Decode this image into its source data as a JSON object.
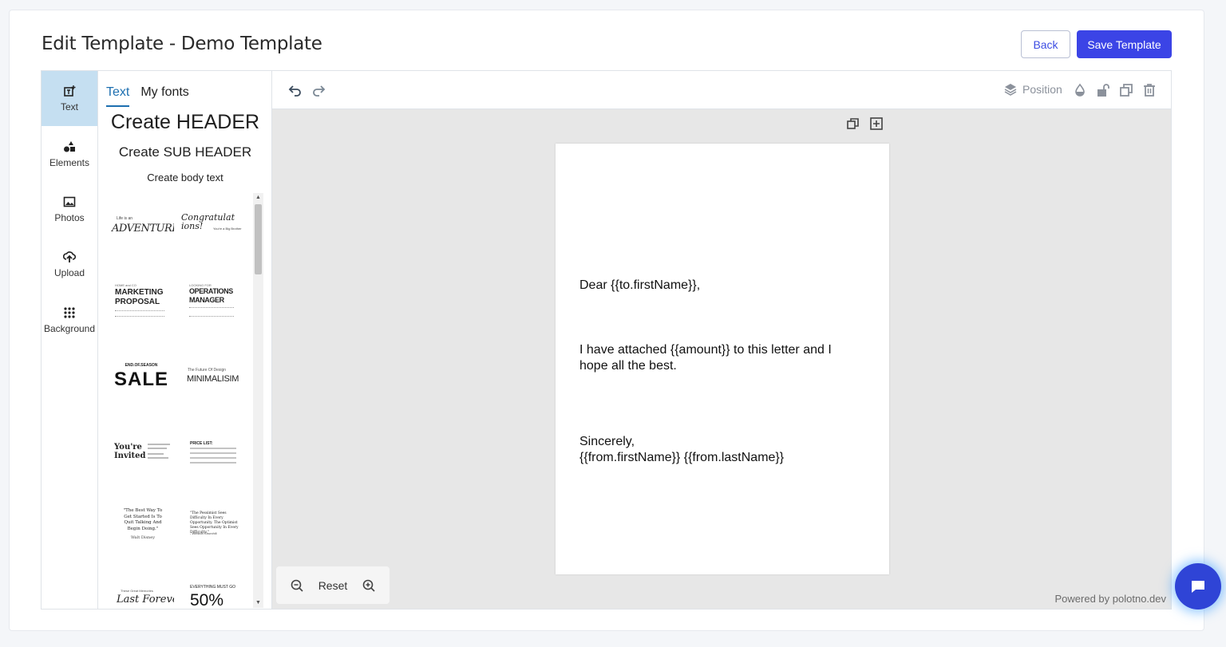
{
  "header": {
    "title": "Edit Template - Demo Template",
    "back_label": "Back",
    "save_label": "Save Template"
  },
  "side_tabs": [
    {
      "label": "Text",
      "icon": "text-add-icon",
      "active": true
    },
    {
      "label": "Elements",
      "icon": "shapes-icon"
    },
    {
      "label": "Photos",
      "icon": "image-icon"
    },
    {
      "label": "Upload",
      "icon": "upload-icon"
    },
    {
      "label": "Background",
      "icon": "dots-grid-icon"
    }
  ],
  "text_panel": {
    "tabs": [
      "Text",
      "My fonts"
    ],
    "active_tab": "Text",
    "create_header": "Create HEADER",
    "create_sub_header": "Create SUB HEADER",
    "create_body": "Create body text",
    "templates": [
      {
        "small": "Life is an",
        "main": "ADVENTURE"
      },
      {
        "main": "Congratulat ions!",
        "small": "You're a Big Brother"
      },
      {
        "small": "HOME and CO",
        "main": "MARKETING PROPOSAL"
      },
      {
        "small": "LOOKING FOR",
        "main": "OPERATIONS MANAGER"
      },
      {
        "small": "END.OF.SEASON",
        "main": "SALE"
      },
      {
        "small": "The Future Of Design",
        "main": "MINIMALISIM"
      },
      {
        "main": "You're Invited"
      },
      {
        "small": "PRICE LIST:"
      },
      {
        "main": "\"The Best Way To Get Started Is To Quit Talking And Begin Doing.\"",
        "small": "Walt Disney"
      },
      {
        "main": "\"The Pessimist Sees Difficulty In Every Opportunity. The Optimist Sees Opportunity In Every Difficulty.\"",
        "small": "- Winston Churchill"
      },
      {
        "small": "These Great Memories",
        "main": "Last Forever"
      },
      {
        "small": "EVERYTHING MUST GO",
        "main": "50%"
      }
    ]
  },
  "toolbar": {
    "undo_icon": "undo-icon",
    "redo_icon": "redo-icon",
    "position_label": "Position"
  },
  "canvas": {
    "lines": [
      "Dear {{to.firstName}},",
      "I have attached {{amount}} to this letter and I",
      "hope all the best.",
      "Sincerely,",
      "{{from.firstName}} {{from.lastName}}"
    ]
  },
  "zoom": {
    "reset_label": "Reset"
  },
  "footer": {
    "powered_by": "Powered by polotno.dev"
  },
  "colors": {
    "accent": "#3b44e6",
    "active_tab_bg": "#c5dff1",
    "link": "#1d6fb0"
  }
}
